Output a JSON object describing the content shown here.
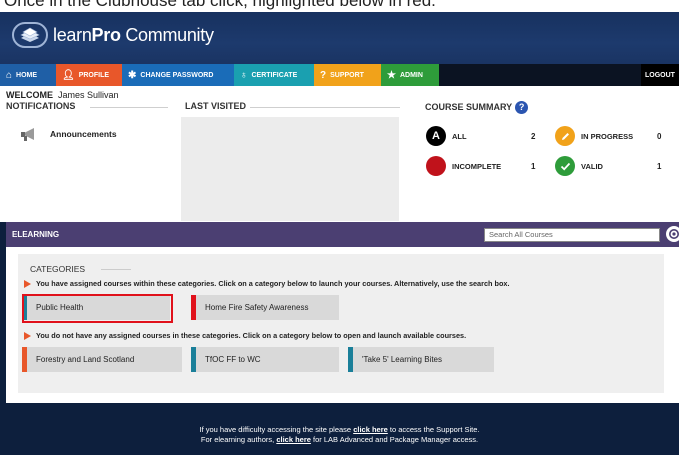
{
  "caption": {
    "text": "Once in the Clubhouse tab click, highlighted below in red."
  },
  "header": {
    "logo_light": "learn",
    "logo_bold": "Pro",
    "logo_tail": " Community"
  },
  "nav": {
    "home": "HOME",
    "profile": "PROFILE",
    "change_password": "CHANGE PASSWORD",
    "certificate": "CERTIFICATE",
    "support": "SUPPORT",
    "admin": "ADMIN",
    "logout": "LOGOUT"
  },
  "welcome": {
    "label": "WELCOME",
    "user": "James Sullivan"
  },
  "notifications": {
    "title": "NOTIFICATIONS",
    "items": [
      "Announcements"
    ]
  },
  "last_visited": {
    "title": "LAST VISITED"
  },
  "course_summary": {
    "title": "COURSE SUMMARY",
    "help": "?",
    "all": {
      "label": "ALL",
      "count": "2",
      "glyph": "A",
      "color": "#000000"
    },
    "in_progress": {
      "label": "IN PROGRESS",
      "count": "0",
      "glyph": "pencil-icon",
      "color": "#f1a21a"
    },
    "incomplete": {
      "label": "INCOMPLETE",
      "count": "1",
      "glyph": "",
      "color": "#c0121b"
    },
    "valid": {
      "label": "VALID",
      "count": "1",
      "glyph": "check-icon",
      "color": "#2e9c3a"
    }
  },
  "elearning": {
    "title": "ELEARNING",
    "search_placeholder": "Search All Courses",
    "categories_title": "CATEGORIES",
    "assigned_text": "You have assigned courses within these categories. Click on a category below to launch your courses. Alternatively, use the search box.",
    "unassigned_text": "You do not have any assigned courses in these categories. Click on a category below to open and launch available courses.",
    "assigned_courses": [
      {
        "label": "Public Health",
        "color": "#1a7f99"
      },
      {
        "label": "Home Fire Safety Awareness",
        "color": "#e0111b"
      }
    ],
    "other_courses": [
      {
        "label": "Forestry and Land Scotland",
        "color": "#e8572a"
      },
      {
        "label": "TfOC FF to WC",
        "color": "#1a7f99"
      },
      {
        "label": "'Take 5' Learning Bites",
        "color": "#1a7f99"
      }
    ]
  },
  "footer": {
    "line1_pre": "If you have difficulty accessing the site please ",
    "line1_link": "click here",
    "line1_post": " to access the Support Site.",
    "line2_pre": "For elearning authors, ",
    "line2_link": "click here",
    "line2_post": " for LAB Advanced and Package Manager access."
  }
}
